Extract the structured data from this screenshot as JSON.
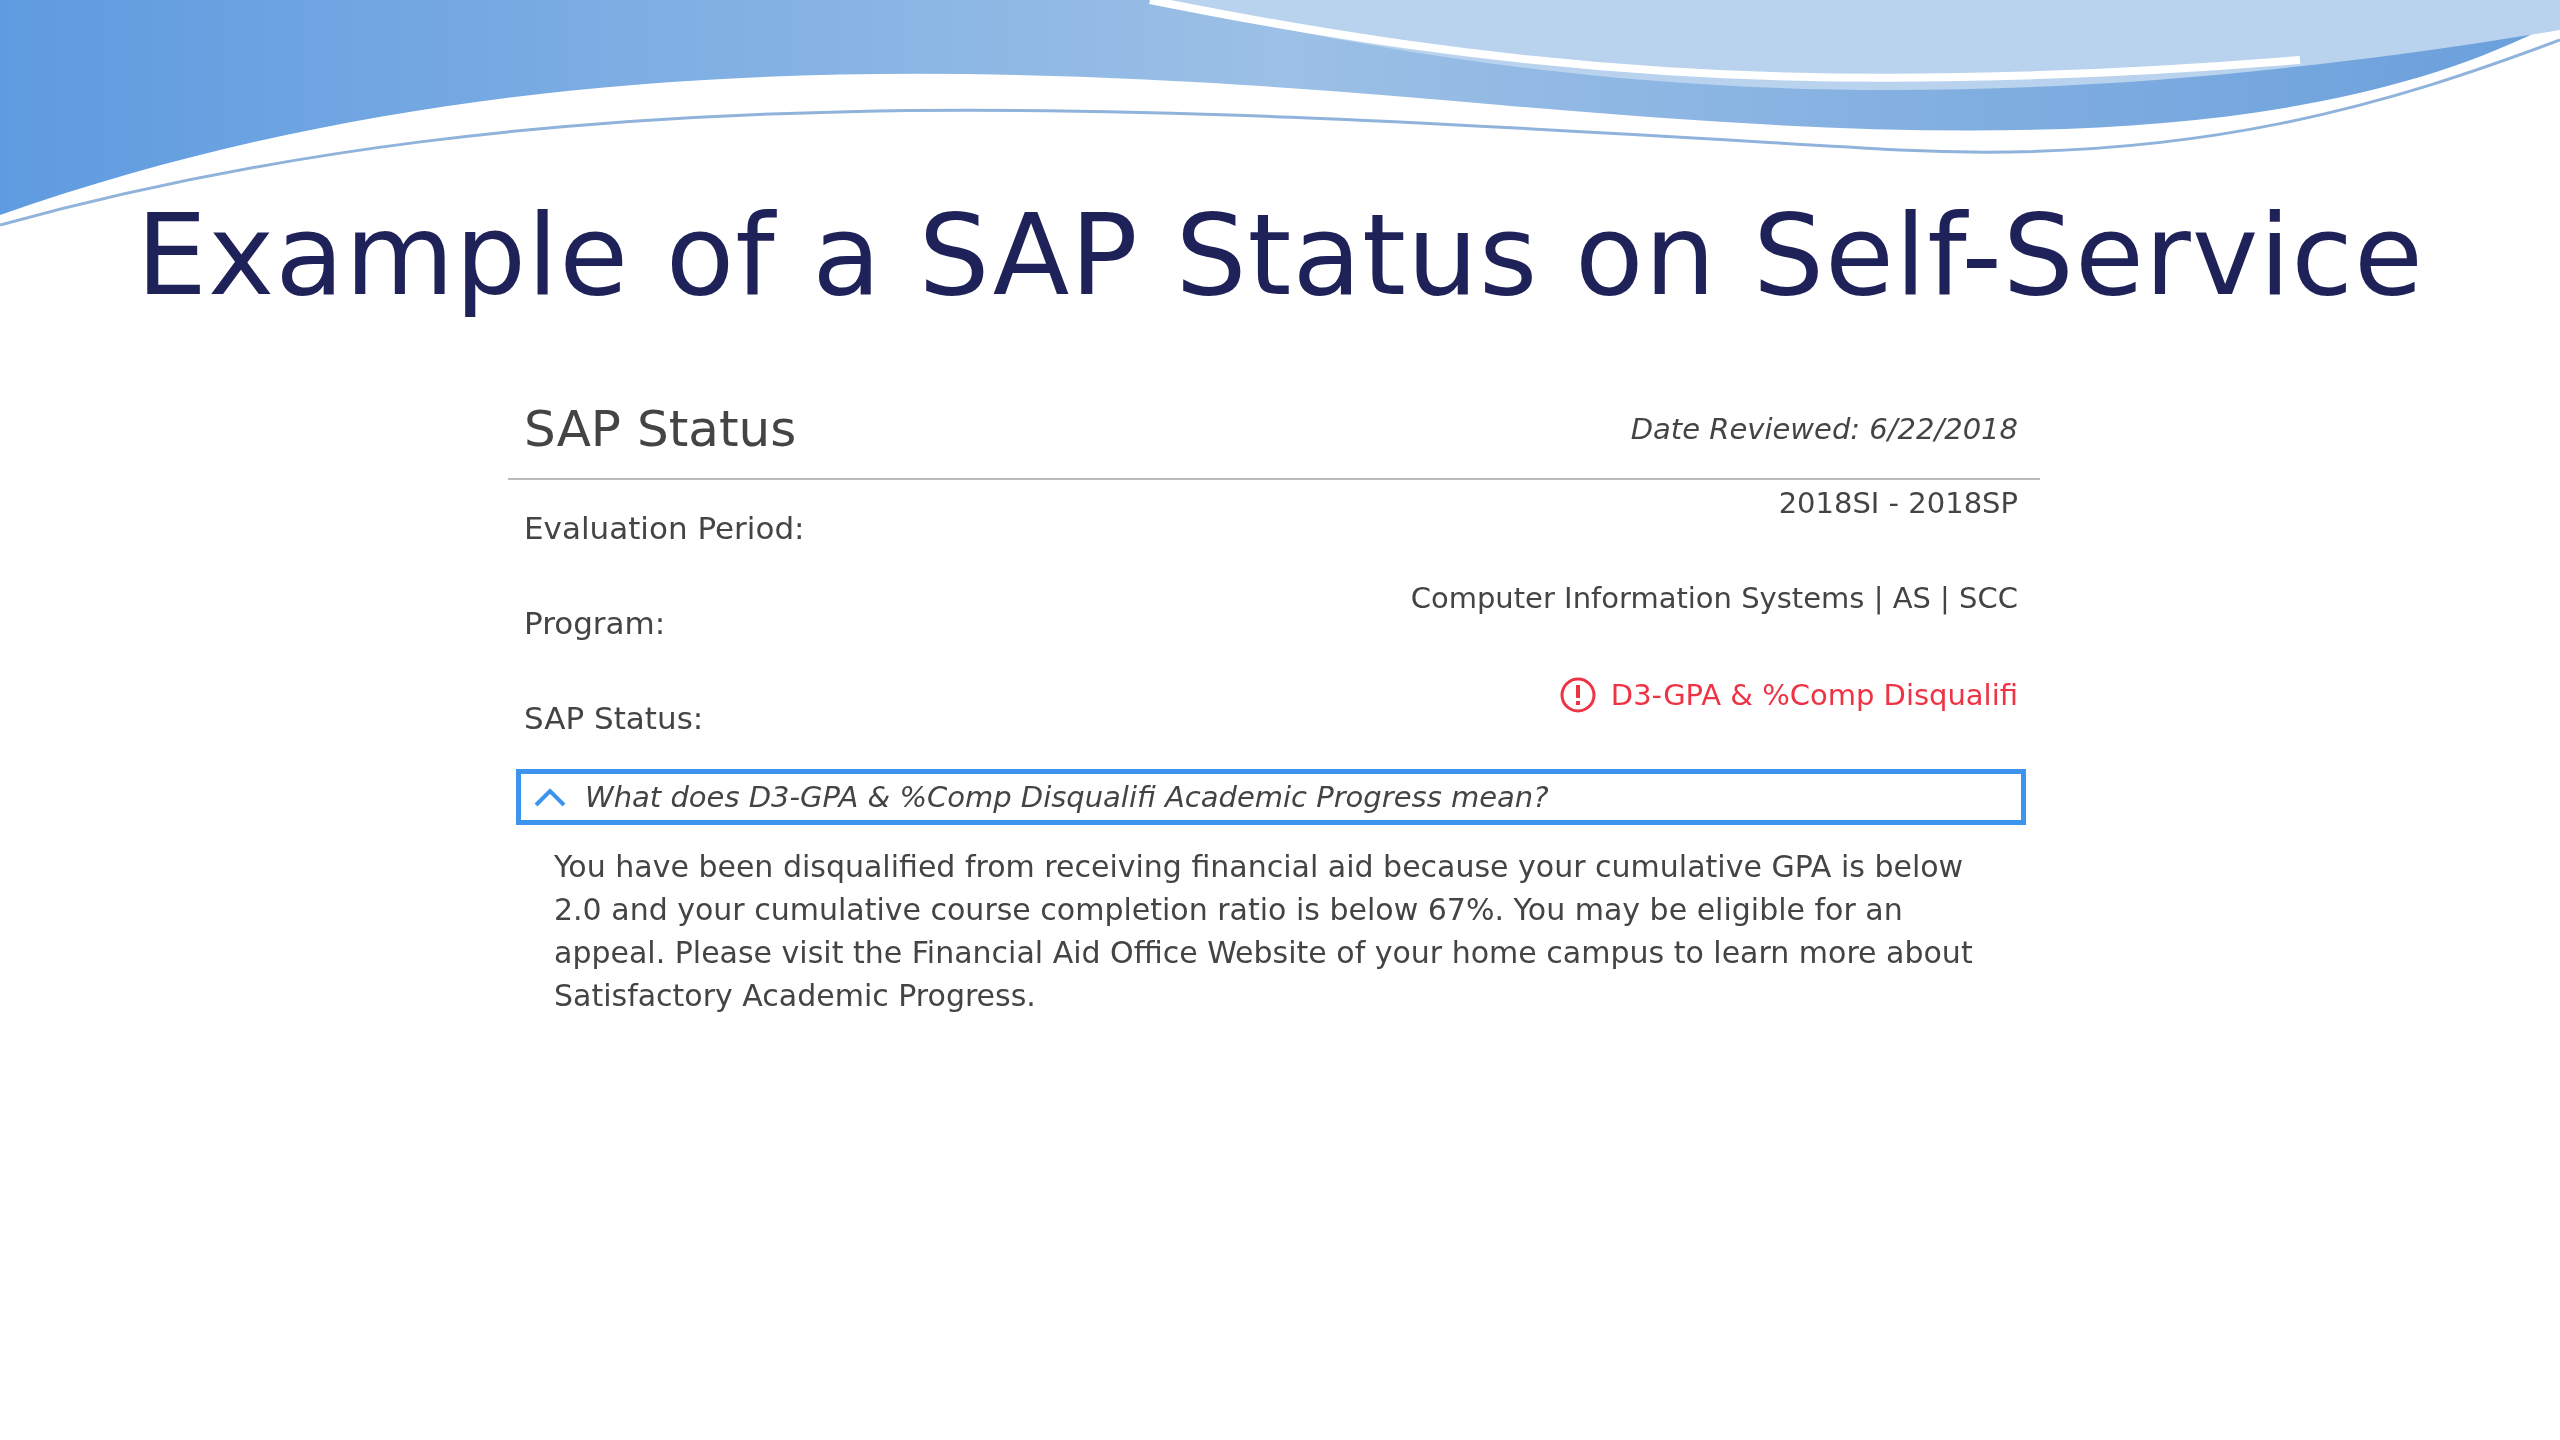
{
  "slide": {
    "title": "Example of a SAP Status on Self-Service"
  },
  "panel": {
    "heading": "SAP Status",
    "date_reviewed": "Date Reviewed: 6/22/2018",
    "fields": [
      {
        "label": "Evaluation Period:",
        "value": "2018SI - 2018SP",
        "kind": "plain"
      },
      {
        "label": "Program:",
        "value": "Computer Information Systems | AS | SCC",
        "kind": "plain"
      },
      {
        "label": "SAP Status:",
        "value": "D3-GPA & %Comp Disqualifi",
        "kind": "alert"
      }
    ],
    "explanation": {
      "question": "What does D3-GPA & %Comp Disqualifi Academic Progress mean?",
      "expanded": true,
      "text": "You have been disqualified from receiving financial aid because your cumulative GPA is below 2.0 and your cumulative course completion ratio is below 67%. You may be eligible for an appeal. Please visit the Financial Aid Office Website of your home campus to learn more about Satisfactory Academic Progress."
    }
  }
}
